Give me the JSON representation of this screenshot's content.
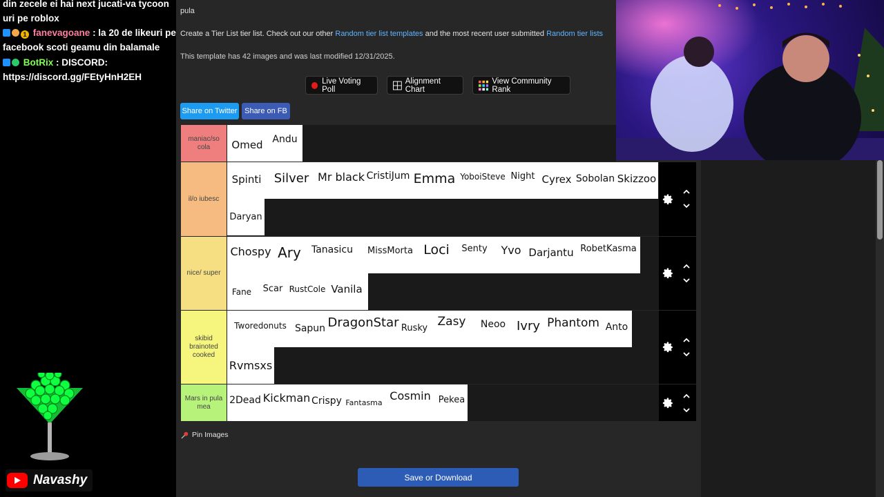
{
  "chat": {
    "messages": [
      {
        "text": "din zecele ei hai next jucati-va tycoon uri pe roblox"
      },
      {
        "user": "fanevagoane",
        "text": ": la 20 de likeuri pe facebook scoti geamu din balamale"
      },
      {
        "user": "BotRix",
        "text": ": DISCORD: https://discord.gg/FEtyHnH2EH"
      }
    ]
  },
  "youtube": {
    "channel": "Navashy"
  },
  "page": {
    "top_text": "pula",
    "intro_prefix": "Create a Tier List tier list. Check out our other ",
    "intro_link1": "Random tier list templates",
    "intro_mid": " and the most recent user submitted ",
    "intro_link2": "Random tier lists",
    "template_info": "This template has 42 images and was last modified 12/31/2025.",
    "buttons": {
      "live_voting": "Live Voting Poll",
      "alignment_chart": "Alignment Chart",
      "community_rank": "View Community Rank"
    },
    "share": {
      "twitter": "Share on Twitter",
      "fb": "Share on FB"
    },
    "pin_images": "Pin Images",
    "save": "Save or Download"
  },
  "tiers": [
    {
      "label": "maniac/so cola",
      "color": "#ef7f7f",
      "items": [
        "Omed",
        "Andu"
      ]
    },
    {
      "label": "il/o iubesc",
      "color": "#f5bb80",
      "items": [
        "Spinti",
        "Silver",
        "Mr black",
        "CristiJum",
        "Emma",
        "YoboiSteve",
        "Night",
        "Cyrex",
        "Sobolan",
        "Skizzoo",
        "Daryan"
      ]
    },
    {
      "label": "nice/ super",
      "color": "#f6de82",
      "items": [
        "Chospy",
        "Ary",
        "Tanasicu",
        "MissMorta",
        "Loci",
        "Senty",
        "Yvo",
        "Darjantu",
        "RobetKasma",
        "Fane",
        "Scar",
        "RustCole",
        "Vanila"
      ]
    },
    {
      "label": "skibid brainoted cooked",
      "color": "#f6f67f",
      "items": [
        "Tworedonuts",
        "Sapun",
        "DragonStar",
        "Rusky",
        "Zasy",
        "Neoo",
        "Ivry",
        "Phantom",
        "Anto",
        "Rvmsxs"
      ]
    },
    {
      "label": "Mars in pula mea",
      "color": "#b7f27b",
      "items": [
        "2Dead",
        "Kickman",
        "Crispy",
        "Fantasma",
        "Cosmin",
        "Pekea"
      ]
    }
  ]
}
